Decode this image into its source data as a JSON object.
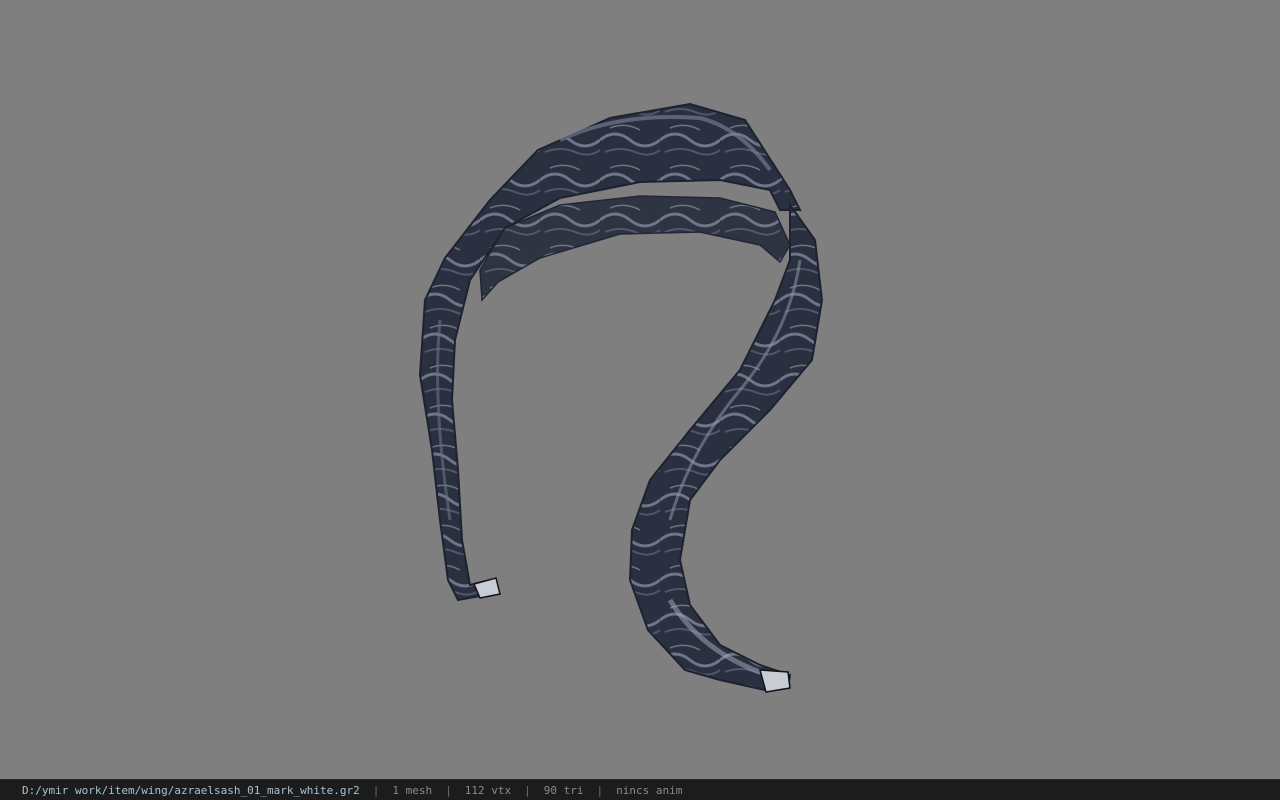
{
  "viewer": {
    "background_color": "#7f7f7f",
    "model_colors": {
      "dark": "#2b3040",
      "mid": "#4a5166",
      "light": "#9aa0b0"
    }
  },
  "status_bar": {
    "file_path": "D:/ymir work/item/wing/azraelsash_01_mark_white.gr2",
    "mesh_count": "1 mesh",
    "vertex_count": "112 vtx",
    "triangle_count": "90 tri",
    "anim_status": "nincs anim",
    "separator": "|"
  }
}
